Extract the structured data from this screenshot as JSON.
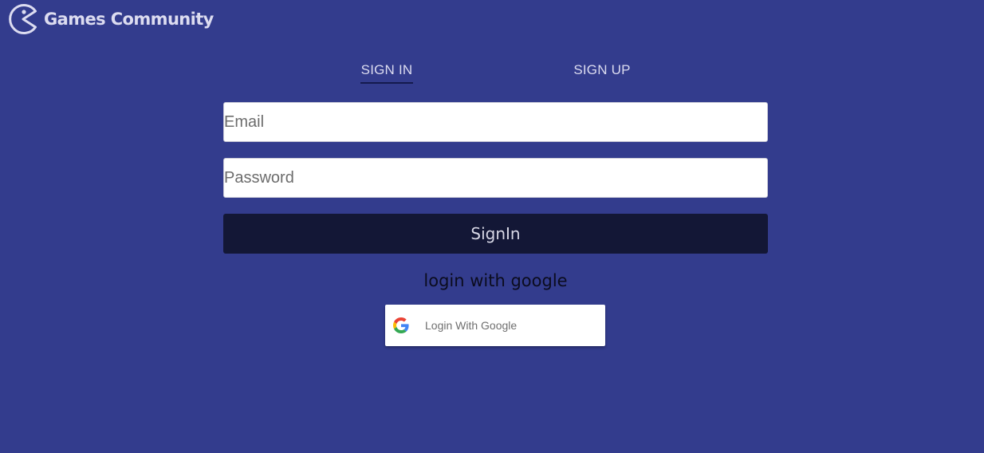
{
  "brand": {
    "name": "Games Community",
    "icon": "pacman-logo-icon"
  },
  "tabs": [
    {
      "label": "SIGN IN",
      "active": true
    },
    {
      "label": "SIGN UP",
      "active": false
    }
  ],
  "form": {
    "email": {
      "placeholder": "Email",
      "value": ""
    },
    "password": {
      "placeholder": "Password",
      "value": ""
    },
    "submit_label": "SignIn"
  },
  "google": {
    "heading": "login with google",
    "button_label": "Login With Google",
    "icon": "google-g-icon"
  },
  "colors": {
    "background": "#333c8d",
    "primary_button": "#131736",
    "tab_indicator": "#141a4e"
  }
}
